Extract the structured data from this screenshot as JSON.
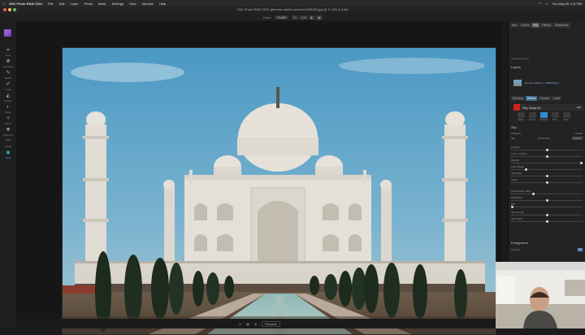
{
  "menubar": {
    "apple": "",
    "items": [
      "ON1 Photo RAW 2022",
      "File",
      "Edit",
      "Layer",
      "Photo",
      "Mask",
      "Settings",
      "View",
      "Window",
      "Help"
    ],
    "clock": "Thu May 26 3:11 PM"
  },
  "window": {
    "title": "ON1 Photo RAW 2022 (jeremie-markid-photos-0098108.jpg @ 71.8% & 8 bit)"
  },
  "toolbar": {
    "zoom_label": "Zoom",
    "zoom_value": "71.8%",
    "fit_buttons": [
      "Fit",
      "100",
      "◧",
      "▣"
    ]
  },
  "left_tools": [
    {
      "icon": "transform-icon",
      "label": "Crop"
    },
    {
      "icon": "transform-icon",
      "label": "Transform"
    },
    {
      "icon": "brush-icon",
      "label": "Brush"
    },
    {
      "icon": "brush-icon",
      "label": "Local"
    },
    {
      "icon": "chisel-icon",
      "label": "Perfect"
    },
    {
      "icon": "mask-icon",
      "label": "Mask"
    },
    {
      "icon": "refine-icon",
      "label": "Refine"
    },
    {
      "icon": "retouch-icon",
      "label": "Retouch"
    },
    {
      "icon": "liquify-icon",
      "label": "Liquify"
    },
    {
      "icon": "view-icon",
      "label": "View"
    }
  ],
  "bottombar": {
    "preview_label": "Preview"
  },
  "right_panel": {
    "tabs": [
      "Nav",
      "Levels",
      "Info",
      "History",
      "Snapshots"
    ],
    "active_tab": "Info",
    "settings_applied": "Settings Applied",
    "layers_label": "Layers",
    "layer_name": "jeremie-markid-p...0098108.jpg",
    "tool_tabs": [
      "Develop",
      "Effects",
      "Portrait",
      "Local"
    ],
    "active_tool_tab": "Effects",
    "filter_name": "Sky Swap AI",
    "filter_opacity": "100",
    "sky_options": [
      "Bright",
      "Sunset",
      "Dramatic",
      "Stars",
      "Mine"
    ],
    "active_sky": "Dramatic",
    "sky_section": "Sky",
    "category_label": "Category",
    "category_value": "Clouds",
    "sky_label": "Sky",
    "sky_value": "Clouds 012",
    "import_label": "Import",
    "sliders": [
      {
        "label": "Position",
        "value": 0.5
      },
      {
        "label": "Horiz. Location",
        "value": 0.5
      },
      {
        "label": "Opacity",
        "value": 1.0
      },
      {
        "label": "Fade Edges",
        "value": 0.2
      },
      {
        "label": "Shift Edge",
        "value": 0.5
      },
      {
        "label": "Scale",
        "value": 0.5
      },
      {
        "label": "Atmospheric Haze",
        "value": 0.3
      },
      {
        "label": "Brightness",
        "value": 0.5
      },
      {
        "label": "Blur",
        "value": 0.0
      },
      {
        "label": "Sky Amount",
        "value": 0.5
      },
      {
        "label": "Sky Bright.",
        "value": 0.5
      }
    ],
    "foreground_label": "Foreground",
    "lighting_label": "Lighting"
  },
  "colors": {
    "accent": "#3fc1c9",
    "selected_tab": "#2c8cd4",
    "sky_top": "#4f9ec8",
    "marble": "#e6e2da"
  }
}
